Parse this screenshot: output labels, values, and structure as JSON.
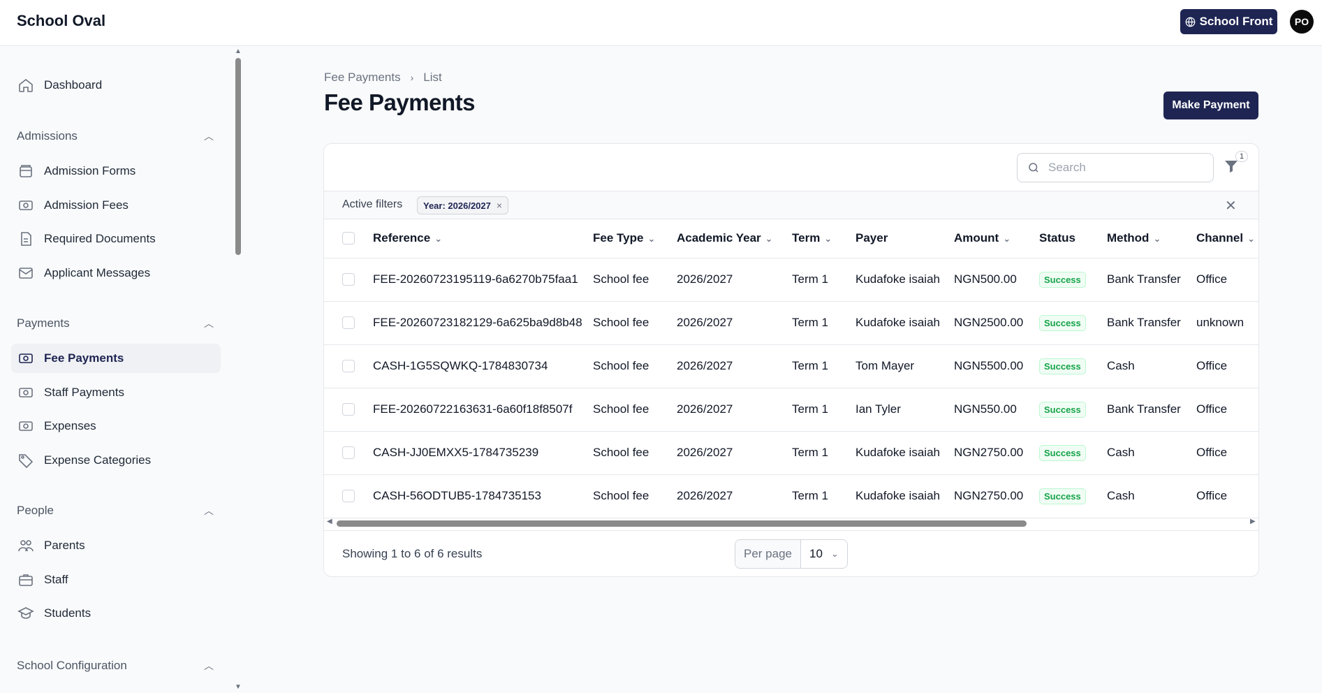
{
  "app": {
    "brand": "School Oval",
    "school_front_label": "School Front",
    "avatar_initials": "PO"
  },
  "sidebar": {
    "dashboard": "Dashboard",
    "groups": [
      {
        "label": "Admissions",
        "items": [
          "Admission Forms",
          "Admission Fees",
          "Required Documents",
          "Applicant Messages"
        ]
      },
      {
        "label": "Payments",
        "items": [
          "Fee Payments",
          "Staff Payments",
          "Expenses",
          "Expense Categories"
        ]
      },
      {
        "label": "People",
        "items": [
          "Parents",
          "Staff",
          "Students"
        ]
      },
      {
        "label": "School Configuration",
        "items": []
      }
    ],
    "active_item": "Fee Payments"
  },
  "breadcrumb": {
    "parent": "Fee Payments",
    "current": "List"
  },
  "page_title": "Fee Payments",
  "make_payment_label": "Make Payment",
  "search": {
    "placeholder": "Search"
  },
  "filter_count": "1",
  "active_filters": {
    "label": "Active filters",
    "chips": [
      "Year: 2026/2027"
    ]
  },
  "table": {
    "columns": [
      "Reference",
      "Fee Type",
      "Academic Year",
      "Term",
      "Payer",
      "Amount",
      "Status",
      "Method",
      "Channel"
    ],
    "rows": [
      [
        "FEE-20260723195119-6a6270b75faa1",
        "School fee",
        "2026/2027",
        "Term 1",
        "Kudafoke isaiah",
        "NGN500.00",
        "Success",
        "Bank Transfer",
        "Office"
      ],
      [
        "FEE-20260723182129-6a625ba9d8b48",
        "School fee",
        "2026/2027",
        "Term 1",
        "Kudafoke isaiah",
        "NGN2500.00",
        "Success",
        "Bank Transfer",
        "unknown"
      ],
      [
        "CASH-1G5SQWKQ-1784830734",
        "School fee",
        "2026/2027",
        "Term 1",
        "Tom Mayer",
        "NGN5500.00",
        "Success",
        "Cash",
        "Office"
      ],
      [
        "FEE-20260722163631-6a60f18f8507f",
        "School fee",
        "2026/2027",
        "Term 1",
        "Ian Tyler",
        "NGN550.00",
        "Success",
        "Bank Transfer",
        "Office"
      ],
      [
        "CASH-JJ0EMXX5-1784735239",
        "School fee",
        "2026/2027",
        "Term 1",
        "Kudafoke isaiah",
        "NGN2750.00",
        "Success",
        "Cash",
        "Office"
      ],
      [
        "CASH-56ODTUB5-1784735153",
        "School fee",
        "2026/2027",
        "Term 1",
        "Kudafoke isaiah",
        "NGN2750.00",
        "Success",
        "Cash",
        "Office"
      ]
    ]
  },
  "pagination": {
    "showing": "Showing 1 to 6 of 6 results",
    "per_page_label": "Per page",
    "per_page_value": "10"
  },
  "colors": {
    "brand": "#1e2553",
    "success": "#16a34a"
  }
}
